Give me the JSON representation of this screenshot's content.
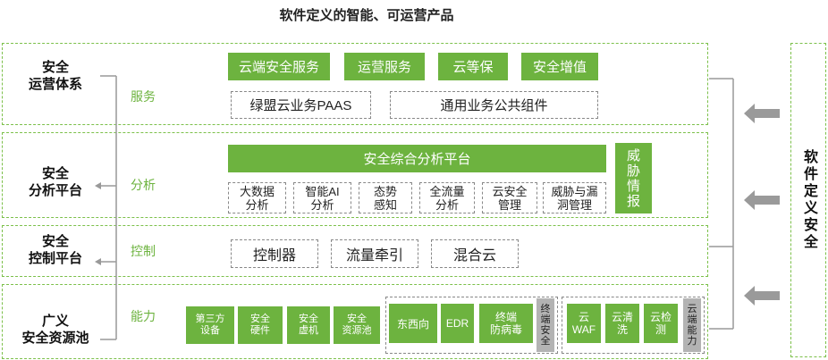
{
  "title": "软件定义的智能、可运营产品",
  "right_panel": {
    "label": "软件定义安全"
  },
  "layers": {
    "ops": {
      "left_label": [
        "安全",
        "运营体系"
      ],
      "category": "服务",
      "green_boxes": [
        "云端安全服务",
        "运营服务",
        "云等保",
        "安全增值"
      ],
      "white_boxes": [
        "绿盟云业务PAAS",
        "通用业务公共组件"
      ]
    },
    "analysis": {
      "left_label": [
        "安全",
        "分析平台"
      ],
      "category": "分析",
      "platform": "安全综合分析平台",
      "intel": [
        "威",
        "胁",
        "情",
        "报"
      ],
      "items": [
        [
          "大数据",
          "分析"
        ],
        [
          "智能AI",
          "分析"
        ],
        [
          "态势",
          "感知"
        ],
        [
          "全流量",
          "分析"
        ],
        [
          "云安全",
          "管理"
        ],
        [
          "威胁与漏",
          "洞管理"
        ]
      ]
    },
    "control": {
      "left_label": [
        "安全",
        "控制平台"
      ],
      "category": "控制",
      "items": [
        "控制器",
        "流量牵引",
        "混合云"
      ]
    },
    "pool": {
      "left_label": [
        "广义",
        "安全资源池"
      ],
      "category": "能力",
      "items": [
        [
          "第三方",
          "设备"
        ],
        [
          "安全",
          "硬件"
        ],
        [
          "安全",
          "虚机"
        ],
        [
          "安全",
          "资源池"
        ]
      ],
      "terminal_group": {
        "items": [
          [
            "东西向"
          ],
          [
            "EDR"
          ],
          [
            "终端",
            "防病毒"
          ]
        ],
        "label": "终端安全"
      },
      "cloud_group": {
        "items": [
          [
            "云",
            "WAF"
          ],
          [
            "云清",
            "洗"
          ],
          [
            "云检",
            "测"
          ]
        ],
        "label": "云端能力"
      }
    }
  }
}
